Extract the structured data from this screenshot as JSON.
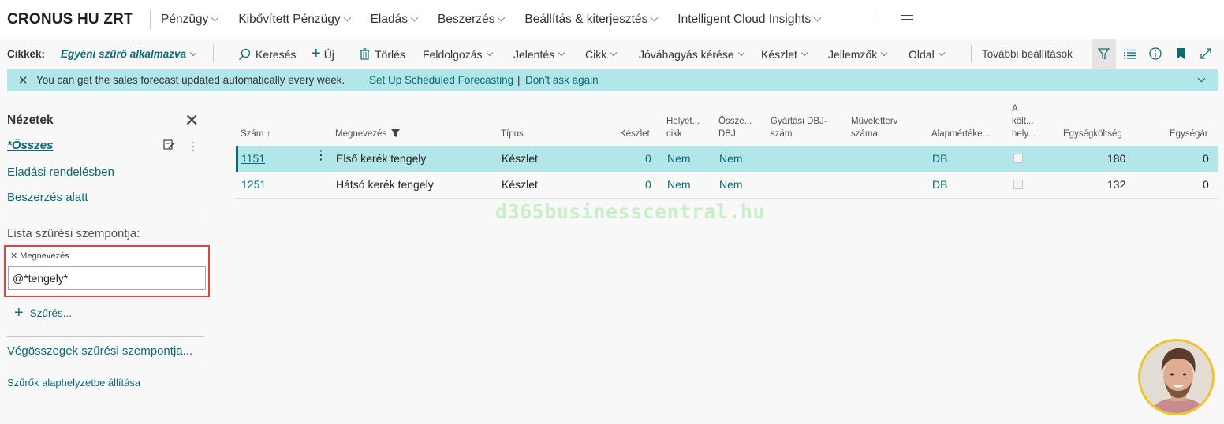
{
  "company": "CRONUS HU ZRT",
  "topnav": [
    {
      "label": "Pénzügy",
      "chevron": true
    },
    {
      "label": "Kibővített Pénzügy",
      "chevron": true
    },
    {
      "label": "Eladás",
      "chevron": true
    },
    {
      "label": "Beszerzés",
      "chevron": true
    },
    {
      "label": "Beállítás & kiterjesztés",
      "chevron": true
    },
    {
      "label": "Intelligent Cloud Insights",
      "chevron": true
    }
  ],
  "actionbar": {
    "page_label": "Cikkek:",
    "filter_label": "Egyéni szűrő alkalmazva",
    "search": "Keresés",
    "new": "Új",
    "delete": "Törlés",
    "process": "Feldolgozás",
    "report": "Jelentés",
    "item": "Cikk",
    "approval": "Jóváhagyás kérése",
    "inventory": "Készlet",
    "attributes": "Jellemzők",
    "page": "Oldal",
    "more": "További beállítások"
  },
  "banner": {
    "message": "You can get the sales forecast updated automatically every week.",
    "link1": "Set Up Scheduled Forecasting",
    "separator": "|",
    "link2": "Don't ask again"
  },
  "filterpane": {
    "title": "Nézetek",
    "views": [
      "*Összes",
      "Eladási rendelésben",
      "Beszerzés alatt"
    ],
    "list_filter_label": "Lista szűrési szempontja:",
    "filter_field": "Megnevezés",
    "filter_value": "@*tengely*",
    "add_filter": "Szűrés...",
    "totals_filter": "Végösszegek szűrési szempontja...",
    "reset": "Szűrők alaphelyzetbe állítása"
  },
  "columns": {
    "no": "Szám ↑",
    "description": "Megnevezés",
    "type": "Típus",
    "inventory": "Készlet",
    "substitutes_1": "Helyet...",
    "substitutes_2": "cikk",
    "assembly_1": "Össze...",
    "assembly_2": "DBJ",
    "prod_bom_1": "Gyártási DBJ-",
    "prod_bom_2": "szám",
    "routing_1": "Műveletterv",
    "routing_2": "száma",
    "base_uom": "Alapmértéke...",
    "cost_adj_1": "A",
    "cost_adj_2": "költ...",
    "cost_adj_3": "hely...",
    "unit_cost": "Egységköltség",
    "unit_price": "Egységár"
  },
  "rows": [
    {
      "no": "1151",
      "description": "Első kerék tengely",
      "type": "Készlet",
      "inventory": "0",
      "substitutes": "Nem",
      "assembly": "Nem",
      "uom": "DB",
      "unit_cost": "180",
      "unit_price": "0"
    },
    {
      "no": "1251",
      "description": "Hátsó kerék tengely",
      "type": "Készlet",
      "inventory": "0",
      "substitutes": "Nem",
      "assembly": "Nem",
      "uom": "DB",
      "unit_cost": "132",
      "unit_price": "0"
    }
  ],
  "watermark": "d365businesscentral.hu",
  "colors": {
    "accent": "#0b6a75",
    "selection": "#b3e6e8",
    "highlight_border": "#d9483b",
    "avatar_ring": "#f2c230"
  }
}
